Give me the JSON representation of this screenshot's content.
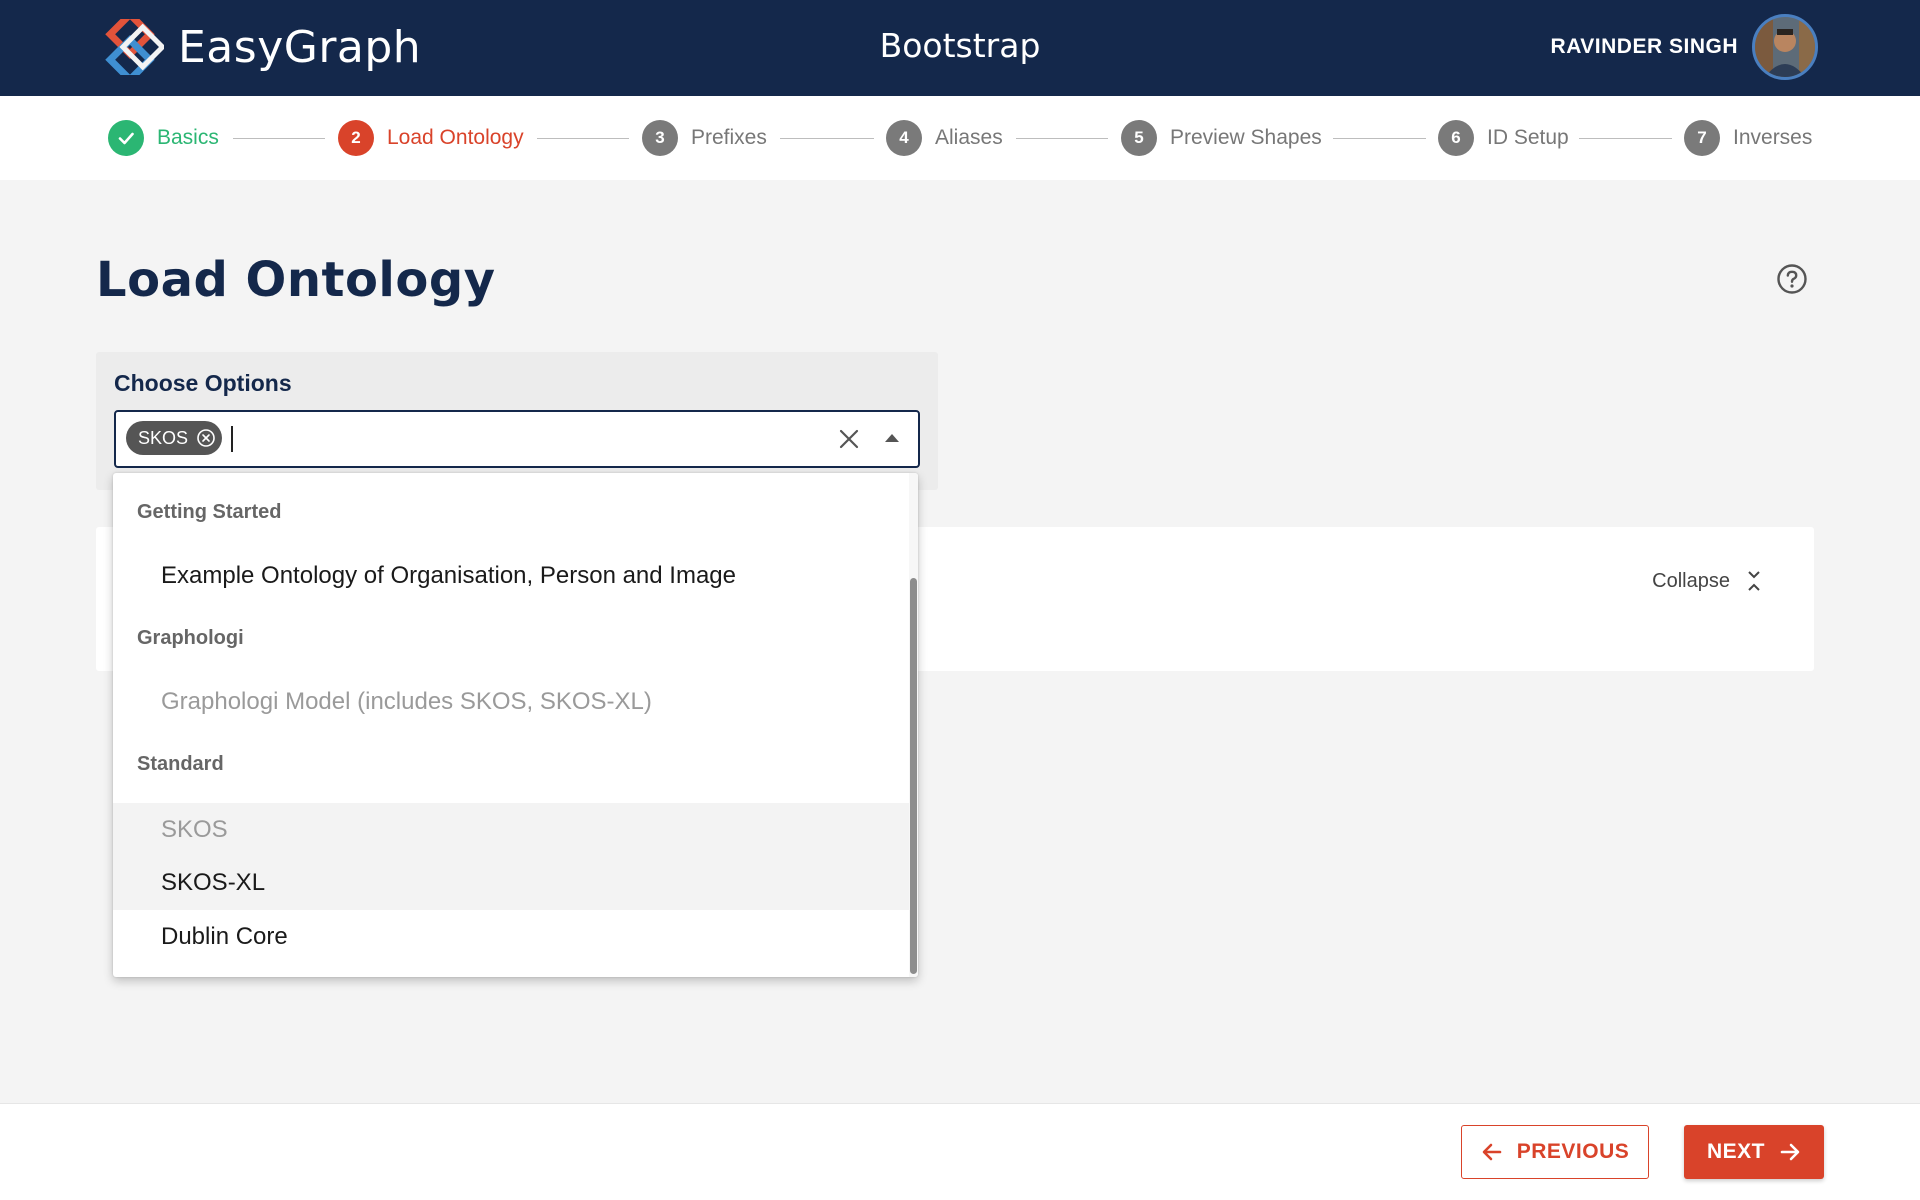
{
  "header": {
    "brand": "EasyGraph",
    "title": "Bootstrap",
    "user_name": "RAVINDER SINGH"
  },
  "stepper": {
    "steps": [
      {
        "number": "1",
        "label": "Basics",
        "state": "done"
      },
      {
        "number": "2",
        "label": "Load Ontology",
        "state": "active"
      },
      {
        "number": "3",
        "label": "Prefixes",
        "state": "pending"
      },
      {
        "number": "4",
        "label": "Aliases",
        "state": "pending"
      },
      {
        "number": "5",
        "label": "Preview Shapes",
        "state": "pending"
      },
      {
        "number": "6",
        "label": "ID Setup",
        "state": "pending"
      },
      {
        "number": "7",
        "label": "Inverses",
        "state": "pending"
      }
    ]
  },
  "main": {
    "title": "Load Ontology",
    "options_label": "Choose Options",
    "selected_chip": "SKOS",
    "input_value": "",
    "collapse_label": "Collapse"
  },
  "dropdown": {
    "groups": [
      {
        "label": "Getting Started",
        "options": [
          {
            "label": "Example Ontology of Organisation, Person and Image",
            "disabled": false
          }
        ]
      },
      {
        "label": "Graphologi",
        "options": [
          {
            "label": "Graphologi Model (includes SKOS, SKOS-XL)",
            "disabled": true
          }
        ]
      },
      {
        "label": "Standard",
        "options": [
          {
            "label": "SKOS",
            "disabled": true
          },
          {
            "label": "SKOS-XL",
            "disabled": false,
            "highlighted": true
          },
          {
            "label": "Dublin Core",
            "disabled": false
          }
        ]
      }
    ]
  },
  "footer": {
    "previous_label": "PREVIOUS",
    "next_label": "NEXT"
  },
  "colors": {
    "header_bg": "#14284b",
    "accent": "#d9432a",
    "success": "#2bb673"
  }
}
